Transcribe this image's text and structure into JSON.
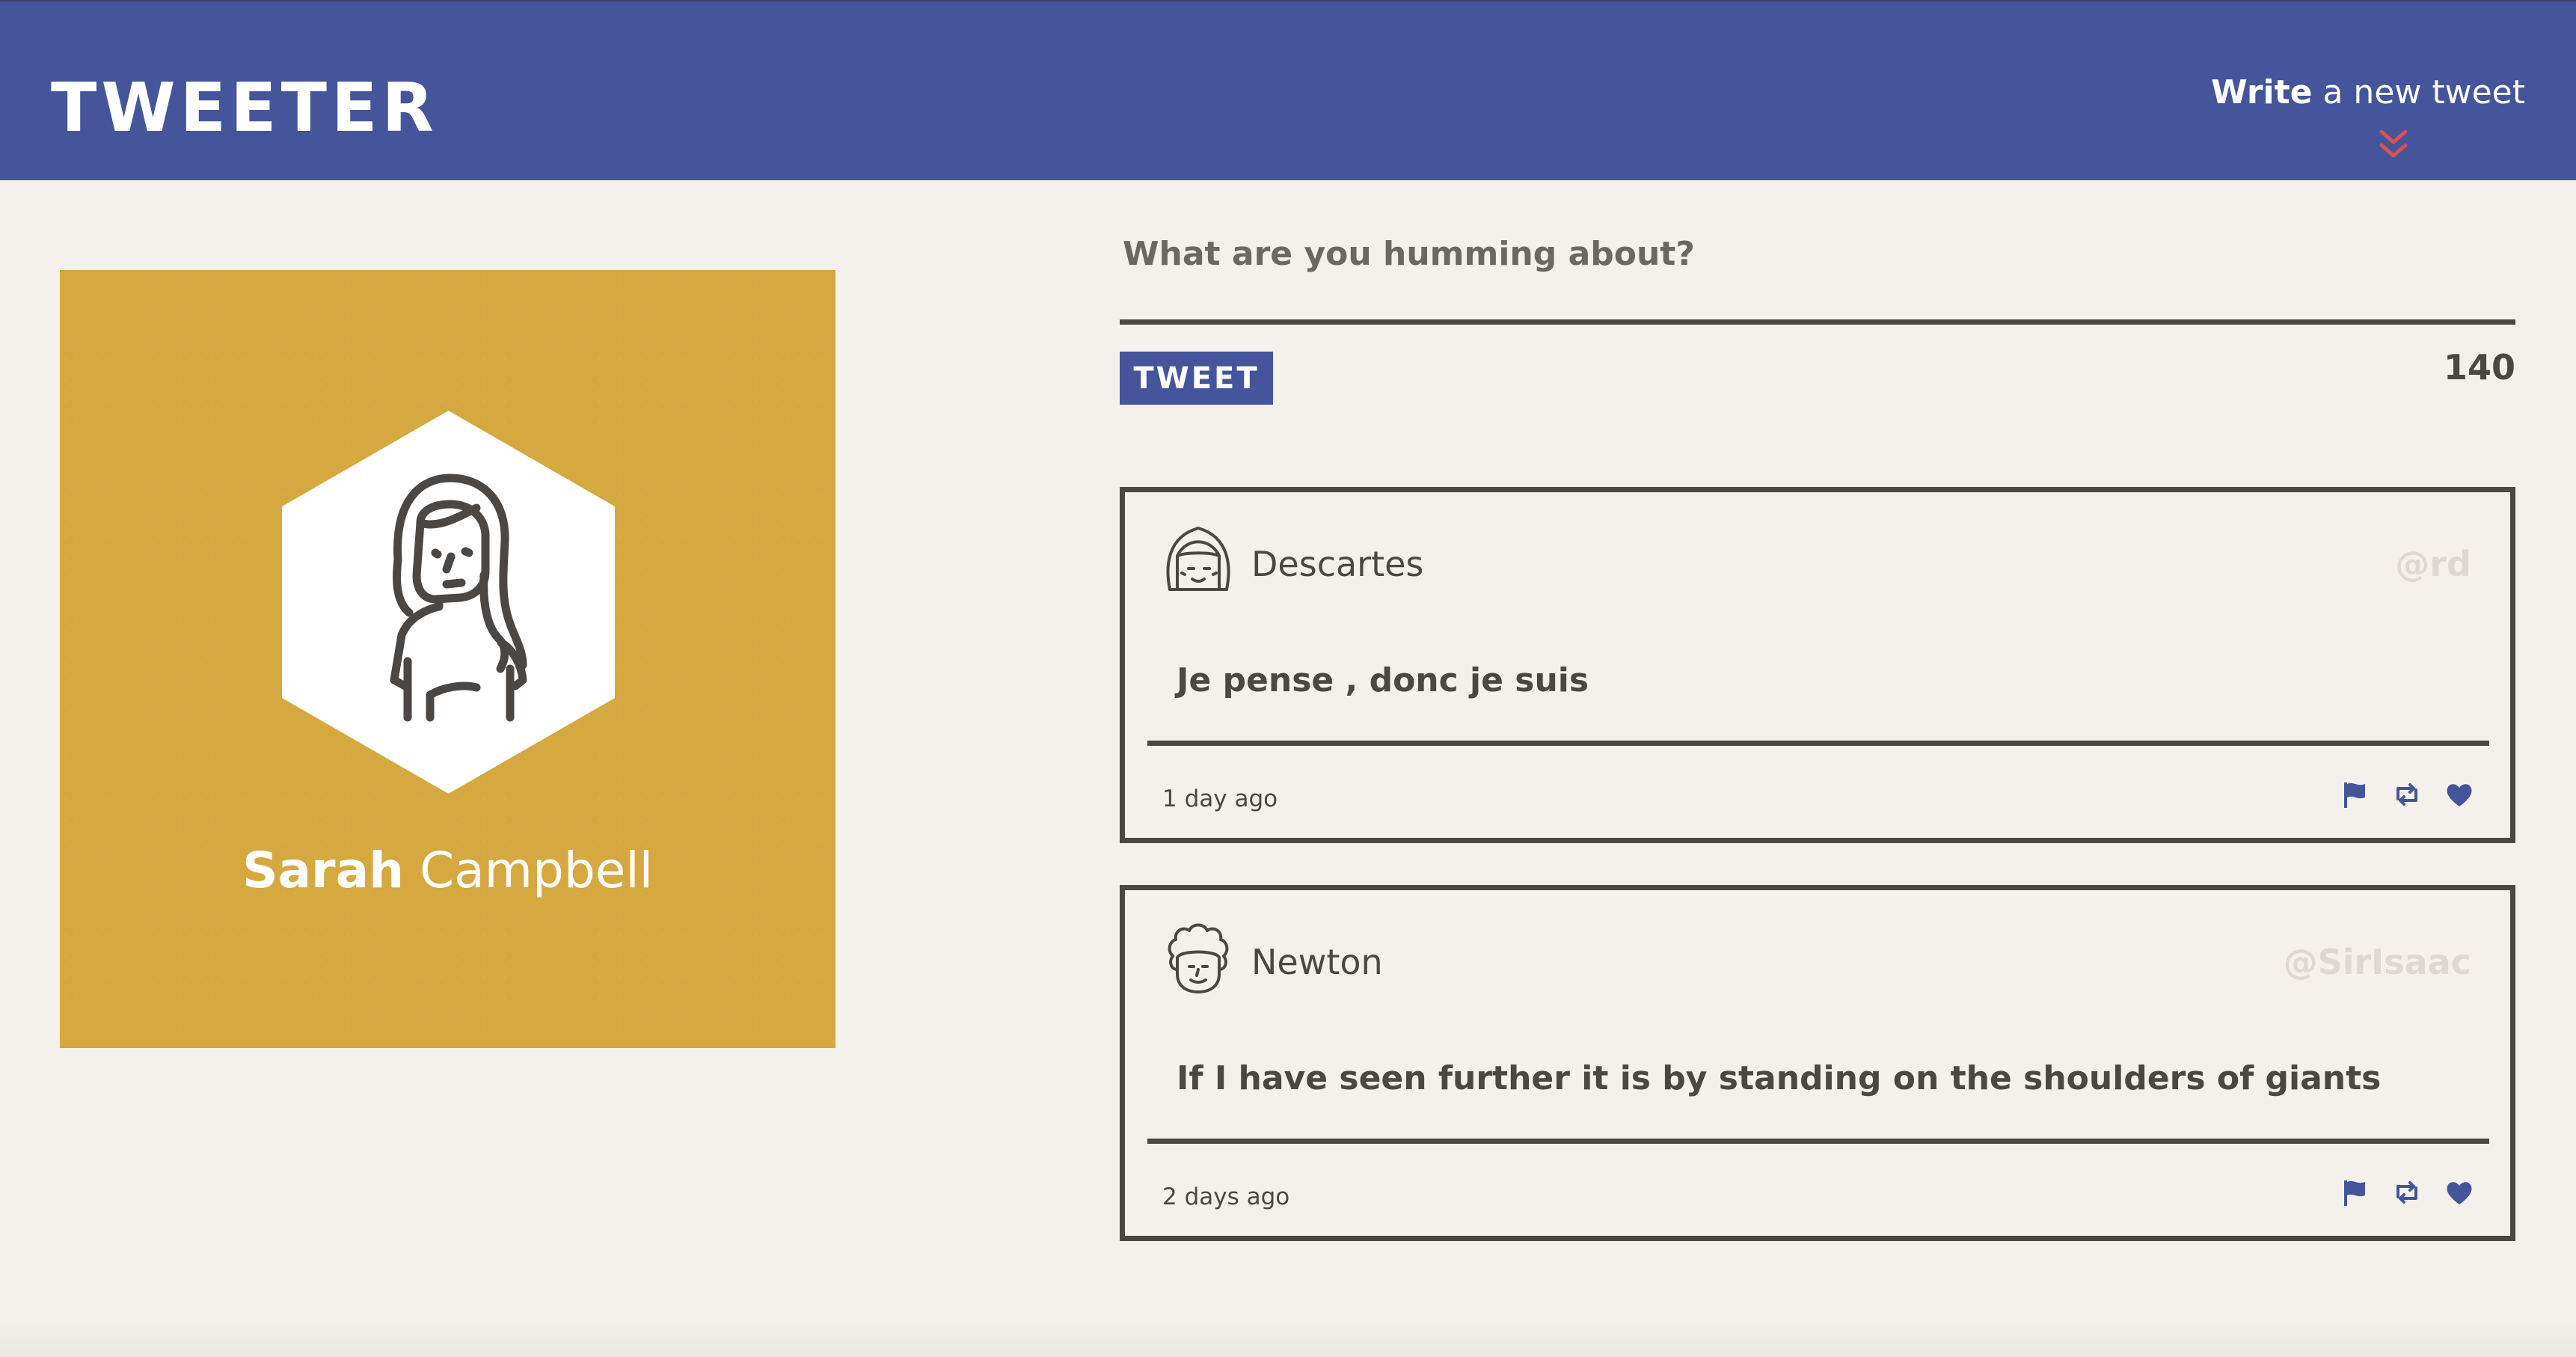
{
  "header": {
    "logo": "TWEETER",
    "compose_toggle_strong": "Write",
    "compose_toggle_rest": " a new tweet",
    "compose_toggle_icon": "double-chevron-down-icon",
    "compose_toggle_icon_color": "#d9534f"
  },
  "colors": {
    "nav_bg": "#44559b",
    "page_bg": "#f4f1ec",
    "profile_bg": "#d5a93f",
    "text_dark": "#4a4744",
    "handle_light": "#ddd8d2"
  },
  "profile": {
    "first_name": "Sarah",
    "last_name": "Campbell",
    "avatar": "woman-avatar-icon"
  },
  "compose": {
    "placeholder": "What are you humming about?",
    "button_label": "TWEET",
    "counter": "140"
  },
  "tweets": [
    {
      "author": "Descartes",
      "handle": "@rd",
      "content": "Je pense , donc je suis",
      "timestamp": "1 day ago",
      "avatar": "bob-hair-avatar-icon",
      "actions": [
        "flag-icon",
        "retweet-icon",
        "heart-icon"
      ]
    },
    {
      "author": "Newton",
      "handle": "@SirIsaac",
      "content": "If I have seen further it is by standing on the shoulders of giants",
      "timestamp": "2 days ago",
      "avatar": "curly-hair-avatar-icon",
      "actions": [
        "flag-icon",
        "retweet-icon",
        "heart-icon"
      ]
    }
  ]
}
